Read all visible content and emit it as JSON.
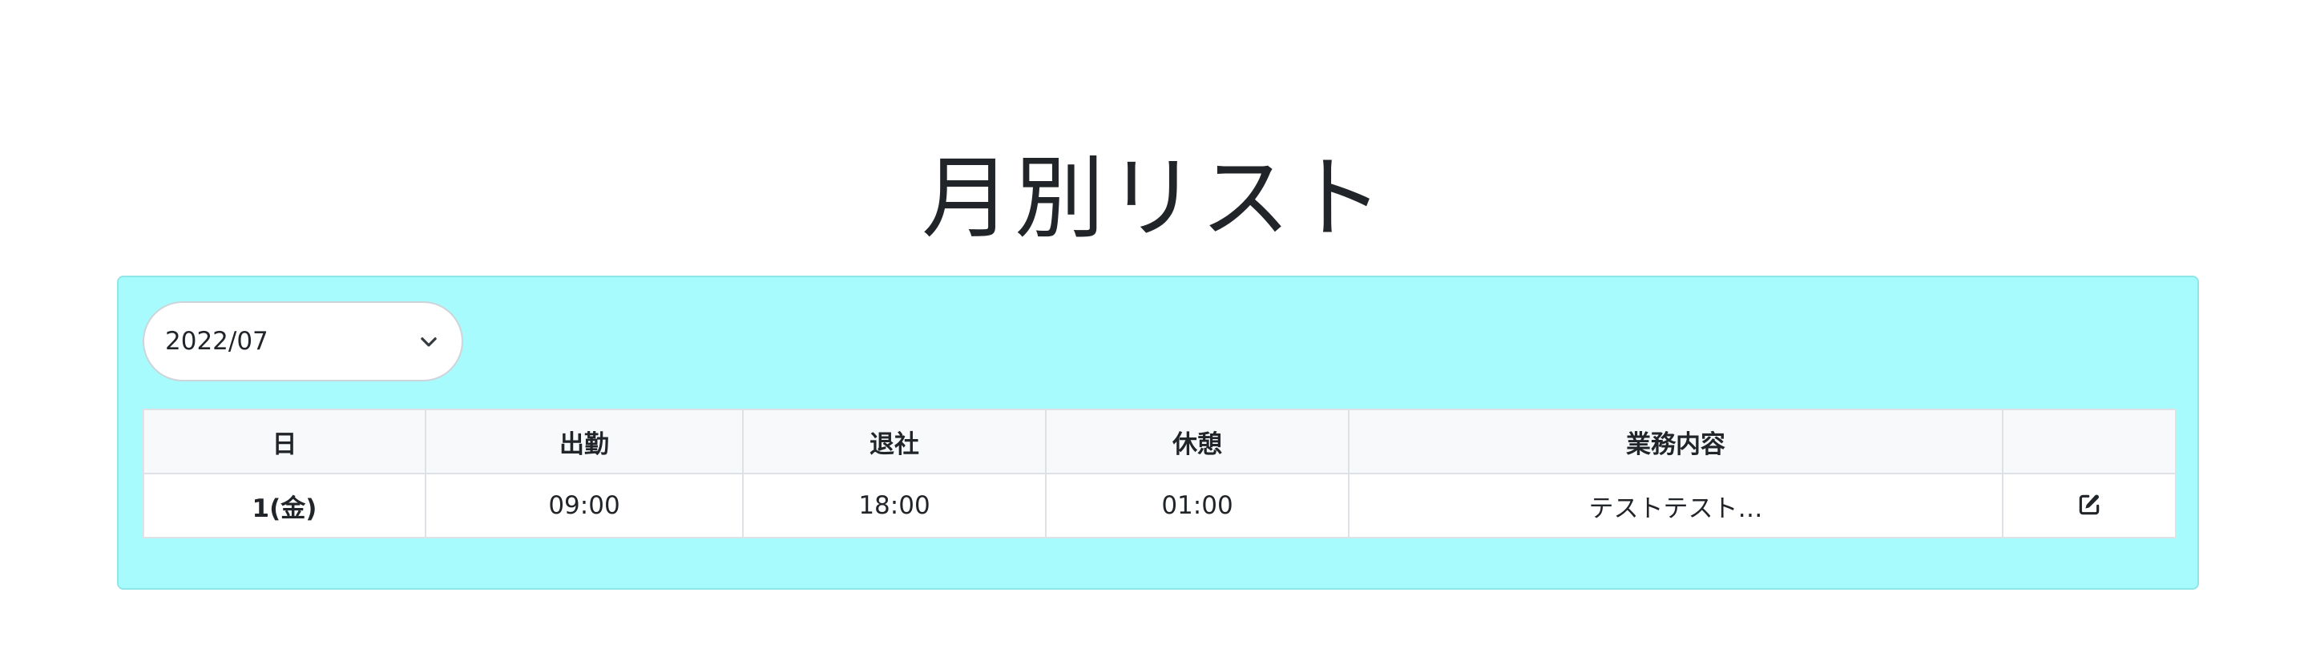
{
  "page": {
    "title": "月別リスト"
  },
  "month_select": {
    "value": "2022/07",
    "icon": "chevron-down-icon"
  },
  "table": {
    "headers": [
      "日",
      "出勤",
      "退社",
      "休憩",
      "業務内容",
      ""
    ],
    "rows": [
      {
        "day": "1(金)",
        "start": "09:00",
        "end": "18:00",
        "break": "01:00",
        "work": "テストテスト…",
        "action_icon": "edit-icon"
      }
    ]
  },
  "colors": {
    "panel_bg": "#a7fbfc",
    "header_bg": "#f8f9fa",
    "text": "#212529"
  }
}
